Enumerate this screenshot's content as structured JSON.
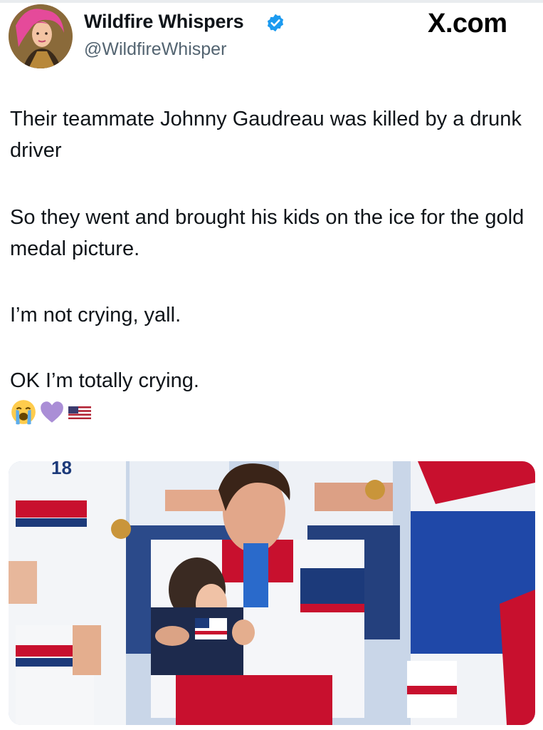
{
  "header": {
    "display_name": "Wildfire Whispers",
    "handle": "@WildfireWhisper",
    "brand": "X.com",
    "avatar_icon": "profile-avatar",
    "verified_icon": "verified-badge-icon",
    "accent_color": "#1d9bf0"
  },
  "tweet": {
    "paragraphs": [
      "Their teammate Johnny Gaudreau was killed by a drunk driver",
      "So they went and brought his kids on the ice for the gold medal picture.",
      "I’m not crying, yall.",
      "OK I’m totally crying."
    ],
    "emojis": [
      "loudly-crying-face-emoji",
      "purple-heart-emoji",
      "us-flag-emoji"
    ]
  },
  "media": {
    "type": "photo",
    "number_top_left": "18",
    "description_icon": "hockey-team-photo"
  }
}
